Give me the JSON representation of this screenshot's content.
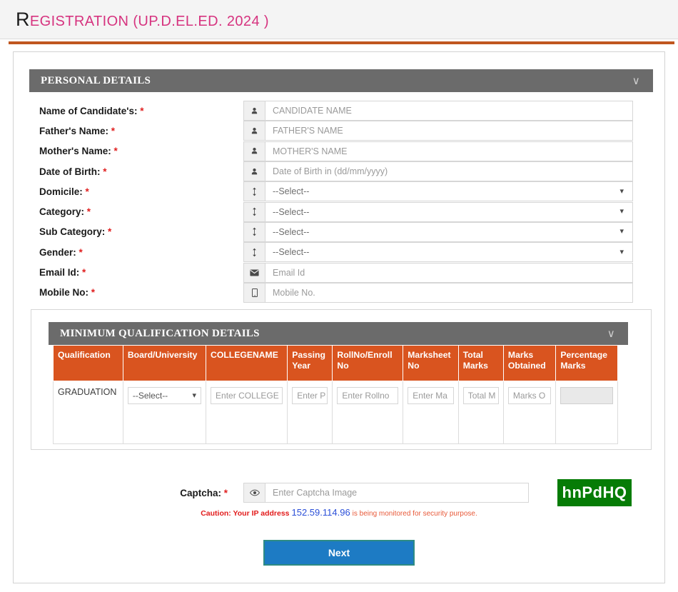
{
  "page": {
    "title_first": "R",
    "title_rest": "EGISTRATION (UP.D.EL.ED. 2024 )"
  },
  "personal_section": {
    "heading": "PERSONAL DETAILS",
    "collapse_icon": "∨",
    "fields": [
      {
        "label": "Name of Candidate's:",
        "required": "*",
        "icon": "user-icon",
        "type": "text",
        "placeholder": "CANDIDATE NAME"
      },
      {
        "label": "Father's Name:",
        "required": "*",
        "icon": "user-icon",
        "type": "text",
        "placeholder": "FATHER'S NAME"
      },
      {
        "label": "Mother's Name:",
        "required": "*",
        "icon": "user-icon",
        "type": "text",
        "placeholder": "MOTHER'S NAME"
      },
      {
        "label": "Date of Birth:",
        "required": "*",
        "icon": "user-icon",
        "type": "text",
        "placeholder": "Date of Birth in (dd/mm/yyyy)"
      },
      {
        "label": "Domicile:",
        "required": "*",
        "icon": "sort-icon",
        "type": "select",
        "placeholder": "--Select--"
      },
      {
        "label": "Category:",
        "required": "*",
        "icon": "sort-icon",
        "type": "select",
        "placeholder": "--Select--"
      },
      {
        "label": "Sub Category:",
        "required": "*",
        "icon": "sort-icon",
        "type": "select",
        "placeholder": "--Select--"
      },
      {
        "label": "Gender:",
        "required": "*",
        "icon": "sort-icon",
        "type": "select",
        "placeholder": "--Select--"
      },
      {
        "label": "Email Id:",
        "required": "*",
        "icon": "envelope-icon",
        "type": "text",
        "placeholder": "Email Id"
      },
      {
        "label": "Mobile No:",
        "required": "*",
        "icon": "mobile-icon",
        "type": "text",
        "placeholder": "Mobile No."
      }
    ]
  },
  "qualification_section": {
    "heading": "MINIMUM QUALIFICATION DETAILS",
    "collapse_icon": "∨",
    "columns": [
      "Qualification",
      "Board/University",
      "COLLEGENAME",
      "Passing Year",
      "RollNo/Enroll No",
      "Marksheet No",
      "Total Marks",
      "Marks Obtained",
      "Percentage Marks"
    ],
    "row": {
      "qualification": "GRADUATION",
      "board_select": "--Select--",
      "college_placeholder": "Enter COLLEGE",
      "passing_year_placeholder": "Enter P",
      "rollno_placeholder": "Enter Rollno",
      "marksheet_placeholder": "Enter Ma",
      "total_marks_placeholder": "Total M",
      "marks_obtained_placeholder": "Marks O",
      "percentage_value": ""
    }
  },
  "captcha": {
    "label": "Captcha:",
    "required": "*",
    "icon": "eye-icon",
    "placeholder": "Enter Captcha Image",
    "image_text": "hnPdHQ",
    "image_bg": "#067c06"
  },
  "caution": {
    "prefix": "Caution: Your IP address",
    "ip": "152.59.114.96",
    "suffix": "is being monitored for security purpose."
  },
  "footer": {
    "next_label": "Next"
  },
  "colors": {
    "accent_orange": "#d9541f",
    "rule_orange": "#c0561f",
    "section_gray": "#6b6b6b",
    "title_pink": "#d6337f",
    "next_blue": "#1d7bc4",
    "next_border": "#2e8b84",
    "required_red": "#e02020",
    "ip_blue": "#2b4fd8"
  }
}
